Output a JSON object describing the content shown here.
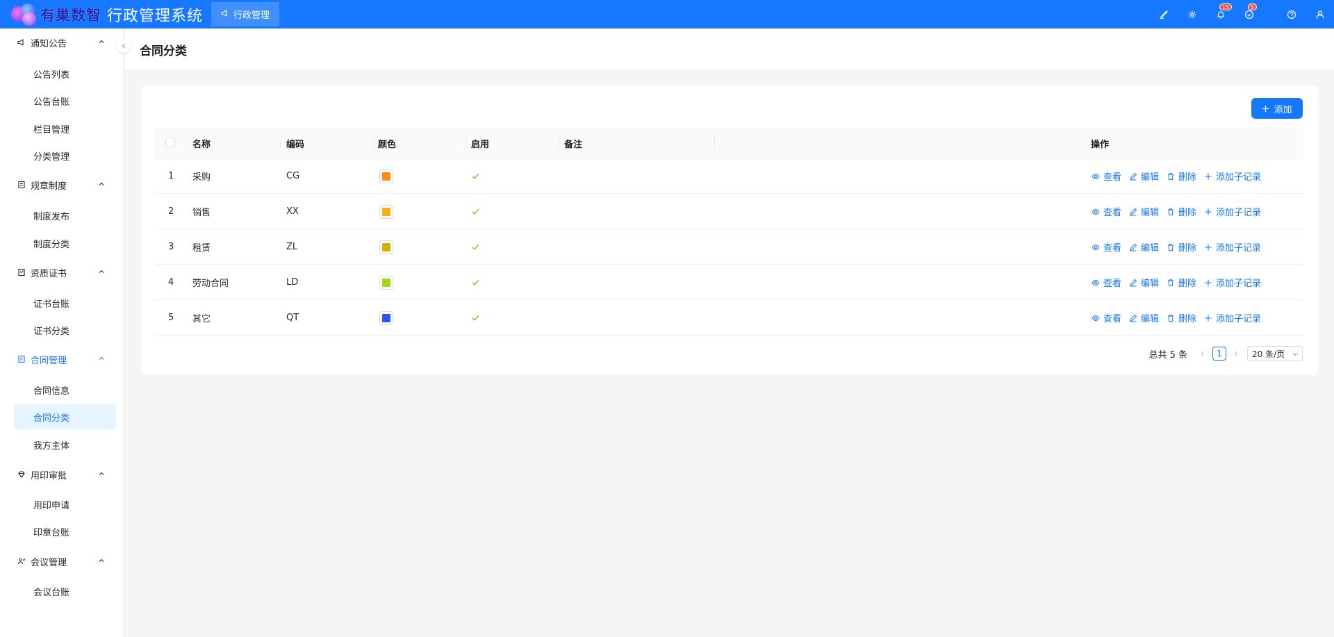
{
  "header": {
    "logo_text": "有巢数智",
    "system_title": "行政管理系统",
    "active_tab": "行政管理",
    "notification_badge": "15",
    "task_badge": "5"
  },
  "sidebar": {
    "groups": [
      {
        "label": "通知公告",
        "icon": "megaphone-icon",
        "items": [
          "公告列表",
          "公告台账",
          "栏目管理",
          "分类管理"
        ]
      },
      {
        "label": "规章制度",
        "icon": "document-icon",
        "items": [
          "制度发布",
          "制度分类"
        ]
      },
      {
        "label": "资质证书",
        "icon": "certificate-icon",
        "items": [
          "证书台账",
          "证书分类"
        ]
      },
      {
        "label": "合同管理",
        "icon": "contract-icon",
        "items": [
          "合同信息",
          "合同分类",
          "我方主体"
        ]
      },
      {
        "label": "用印审批",
        "icon": "seal-icon",
        "items": [
          "用印申请",
          "印章台账"
        ]
      },
      {
        "label": "会议管理",
        "icon": "meeting-icon",
        "items": [
          "会议台账"
        ]
      }
    ],
    "active_item": "合同分类"
  },
  "page": {
    "title": "合同分类",
    "add_label": "添加"
  },
  "table": {
    "columns": {
      "name": "名称",
      "code": "编码",
      "color": "颜色",
      "enabled": "启用",
      "remark": "备注",
      "actions": "操作"
    },
    "action_labels": {
      "view": "查看",
      "edit": "编辑",
      "delete": "删除",
      "add_child": "添加子记录"
    },
    "rows": [
      {
        "index": "1",
        "name": "采购",
        "code": "CG",
        "color": "#fa8c16",
        "enabled": true,
        "remark": ""
      },
      {
        "index": "2",
        "name": "销售",
        "code": "XX",
        "color": "#faad14",
        "enabled": true,
        "remark": ""
      },
      {
        "index": "3",
        "name": "租赁",
        "code": "ZL",
        "color": "#d4b106",
        "enabled": true,
        "remark": ""
      },
      {
        "index": "4",
        "name": "劳动合同",
        "code": "LD",
        "color": "#a0d911",
        "enabled": true,
        "remark": ""
      },
      {
        "index": "5",
        "name": "其它",
        "code": "QT",
        "color": "#2f54eb",
        "enabled": true,
        "remark": ""
      }
    ]
  },
  "pagination": {
    "total_text": "总共 5 条",
    "current_page": "1",
    "page_size": "20 条/页"
  },
  "colors": {
    "primary": "#1677ff",
    "success": "#52c41a"
  }
}
